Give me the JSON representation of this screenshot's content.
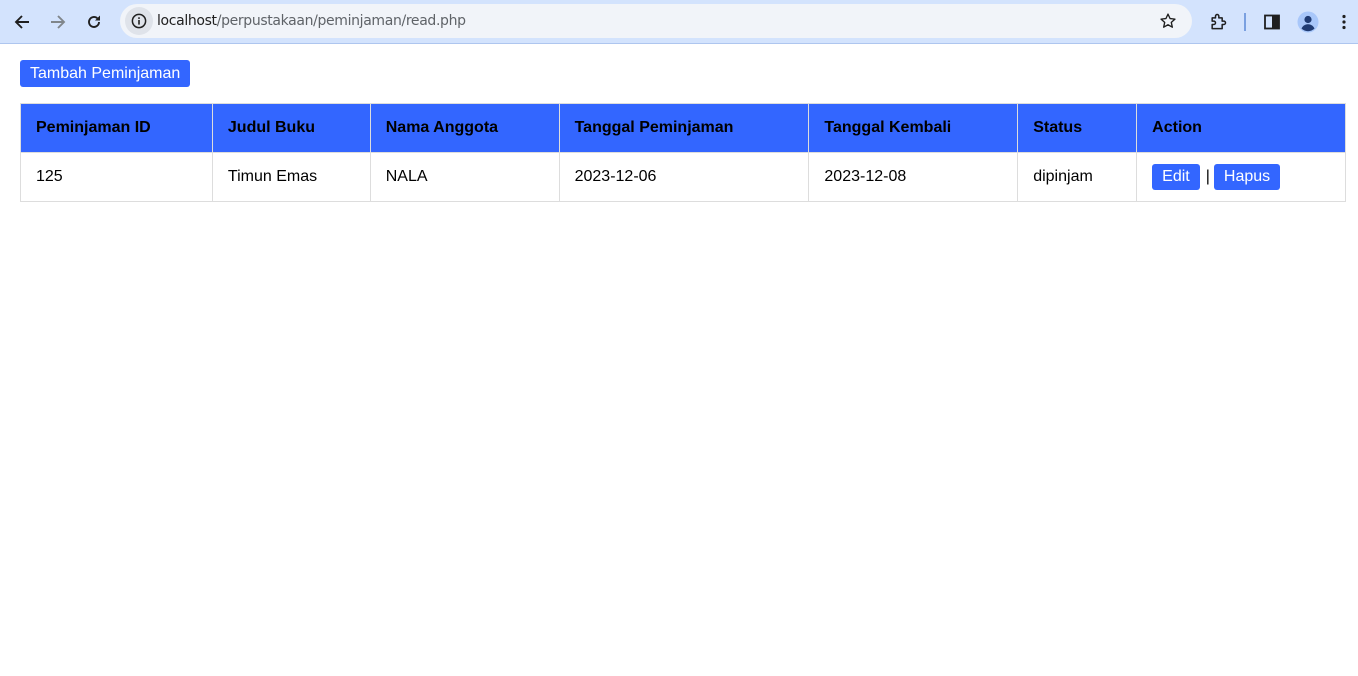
{
  "browser": {
    "url_host": "localhost",
    "url_path": "/perpustakaan/peminjaman/read.php",
    "icons": [
      "back-icon",
      "forward-icon",
      "reload-icon",
      "site-info-icon",
      "bookmark-star-icon",
      "extensions-icon",
      "side-panel-icon",
      "profile-icon",
      "menu-icon"
    ]
  },
  "page": {
    "add_button": "Tambah Peminjaman",
    "table": {
      "headers": [
        "Peminjaman ID",
        "Judul Buku",
        "Nama Anggota",
        "Tanggal Peminjaman",
        "Tanggal Kembali",
        "Status",
        "Action"
      ],
      "rows": [
        {
          "id": "125",
          "judul": "Timun Emas",
          "nama": "NALA",
          "tgl_pinjam": "2023-12-06",
          "tgl_kembali": "2023-12-08",
          "status": "dipinjam",
          "edit_label": "Edit",
          "separator": "|",
          "hapus_label": "Hapus"
        }
      ]
    }
  },
  "colors": {
    "accent": "#3366ff",
    "toolbar": "#d3e3fd",
    "border": "#dddddd"
  }
}
